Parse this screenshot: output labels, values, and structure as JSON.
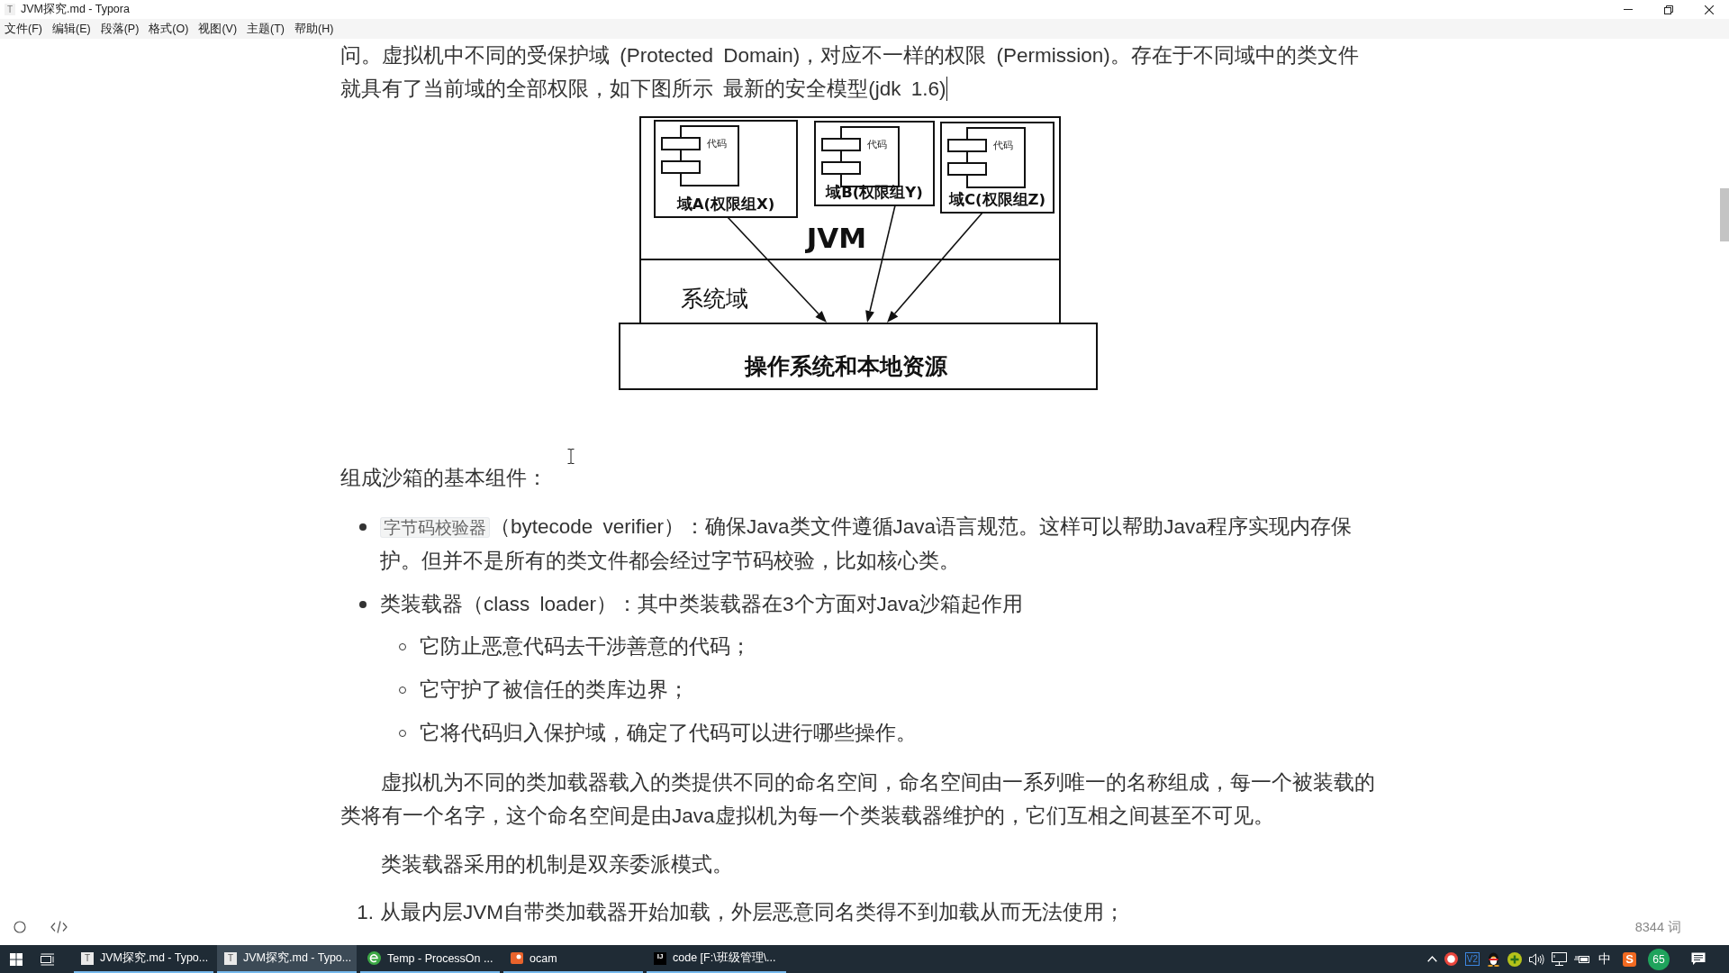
{
  "window": {
    "title": "JVM探究.md - Typora",
    "icon_text": "T"
  },
  "menu": [
    "文件(F)",
    "编辑(E)",
    "段落(P)",
    "格式(O)",
    "视图(V)",
    "主题(T)",
    "帮助(H)"
  ],
  "document": [
    {
      "kind": "paragraph",
      "text": "问。虚拟机中不同的受保护域 (Protected Domain)，对应不一样的权限 (Permission)。存在于不同域中的类文件就具有了当前域的全部权限，如下图所示 最新的安全模型(jdk 1.6)",
      "caret": true
    },
    {
      "kind": "figure",
      "domains": [
        {
          "label": "域A(权限组X)",
          "code_label": "代码"
        },
        {
          "label": "域B(权限组Y)",
          "code_label": "代码"
        },
        {
          "label": "域C(权限组Z)",
          "code_label": "代码"
        }
      ],
      "jvm_label": "JVM",
      "system_label": "系统域",
      "os_label": "操作系统和本地资源"
    },
    {
      "kind": "heading-text",
      "text": "组成沙箱的基本组件："
    },
    {
      "kind": "bullets",
      "items": [
        {
          "segments": [
            {
              "kind": "code",
              "text": "字节码校验器"
            },
            {
              "kind": "text",
              "text": "（bytecode verifier）：确保Java类文件遵循Java语言规范。这样可以帮助Java程序实现内存保护。但并不是所有的类文件都会经过字节码校验，比如核心类。"
            }
          ]
        },
        {
          "segments": [
            {
              "kind": "text",
              "text": "类装载器（class loader）：其中类装载器在3个方面对Java沙箱起作用"
            }
          ],
          "children": [
            {
              "segments": [
                {
                  "kind": "text",
                  "text": "它防止恶意代码去干涉善意的代码；"
                }
              ]
            },
            {
              "segments": [
                {
                  "kind": "text",
                  "text": "它守护了被信任的类库边界；"
                }
              ]
            },
            {
              "segments": [
                {
                  "kind": "text",
                  "text": "它将代码归入保护域，确定了代码可以进行哪些操作。"
                }
              ]
            }
          ]
        }
      ]
    },
    {
      "kind": "indented",
      "text": "虚拟机为不同的类加载器载入的类提供不同的命名空间，命名空间由一系列唯一的名称组成，每一个被装载的类将有一个名字，这个命名空间是由Java虚拟机为每一个类装载器维护的，它们互相之间甚至不可见。"
    },
    {
      "kind": "indented",
      "text": "类装载器采用的机制是双亲委派模式。"
    },
    {
      "kind": "numbered",
      "items": [
        {
          "number": "1.",
          "text": "从最内层JVM自带类加载器开始加载，外层恶意同名类得不到加载从而无法使用；"
        }
      ]
    }
  ],
  "footer": {
    "word_count": "8344 词"
  },
  "taskbar": {
    "windows": [
      {
        "kind": "editor",
        "icon_text": "T",
        "label": "JVM探究.md - Typo...",
        "selected": false
      },
      {
        "kind": "editor",
        "icon_text": "T",
        "label": "JVM探究.md - Typo...",
        "selected": true
      },
      {
        "kind": "browser",
        "label": "Temp - ProcessOn ...",
        "selected": false
      },
      {
        "kind": "recorder",
        "label": "ocam",
        "selected": false
      },
      {
        "kind": "ide",
        "icon_text": "IJ",
        "label": "code [F:\\班级管理\\...",
        "selected": false
      }
    ],
    "tray": [
      {
        "kind": "chevron"
      },
      {
        "kind": "ring"
      },
      {
        "kind": "letter-box",
        "text": "V2"
      },
      {
        "kind": "penguin"
      },
      {
        "kind": "plus"
      },
      {
        "kind": "speaker"
      },
      {
        "kind": "network"
      },
      {
        "kind": "battery"
      },
      {
        "kind": "ime",
        "text": "中"
      },
      {
        "kind": "letter-tile",
        "text": "S"
      },
      {
        "kind": "counter",
        "text": "65"
      },
      {
        "kind": "notifications"
      }
    ]
  }
}
